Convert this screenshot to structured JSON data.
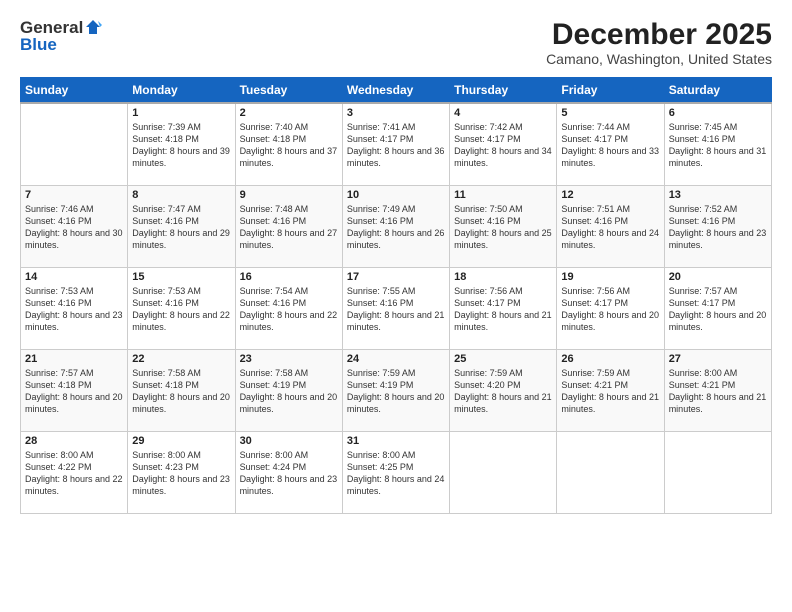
{
  "header": {
    "logo_general": "General",
    "logo_blue": "Blue",
    "month": "December 2025",
    "location": "Camano, Washington, United States"
  },
  "days_of_week": [
    "Sunday",
    "Monday",
    "Tuesday",
    "Wednesday",
    "Thursday",
    "Friday",
    "Saturday"
  ],
  "weeks": [
    [
      {
        "day": "",
        "sunrise": "",
        "sunset": "",
        "daylight": ""
      },
      {
        "day": "1",
        "sunrise": "Sunrise: 7:39 AM",
        "sunset": "Sunset: 4:18 PM",
        "daylight": "Daylight: 8 hours and 39 minutes."
      },
      {
        "day": "2",
        "sunrise": "Sunrise: 7:40 AM",
        "sunset": "Sunset: 4:18 PM",
        "daylight": "Daylight: 8 hours and 37 minutes."
      },
      {
        "day": "3",
        "sunrise": "Sunrise: 7:41 AM",
        "sunset": "Sunset: 4:17 PM",
        "daylight": "Daylight: 8 hours and 36 minutes."
      },
      {
        "day": "4",
        "sunrise": "Sunrise: 7:42 AM",
        "sunset": "Sunset: 4:17 PM",
        "daylight": "Daylight: 8 hours and 34 minutes."
      },
      {
        "day": "5",
        "sunrise": "Sunrise: 7:44 AM",
        "sunset": "Sunset: 4:17 PM",
        "daylight": "Daylight: 8 hours and 33 minutes."
      },
      {
        "day": "6",
        "sunrise": "Sunrise: 7:45 AM",
        "sunset": "Sunset: 4:16 PM",
        "daylight": "Daylight: 8 hours and 31 minutes."
      }
    ],
    [
      {
        "day": "7",
        "sunrise": "Sunrise: 7:46 AM",
        "sunset": "Sunset: 4:16 PM",
        "daylight": "Daylight: 8 hours and 30 minutes."
      },
      {
        "day": "8",
        "sunrise": "Sunrise: 7:47 AM",
        "sunset": "Sunset: 4:16 PM",
        "daylight": "Daylight: 8 hours and 29 minutes."
      },
      {
        "day": "9",
        "sunrise": "Sunrise: 7:48 AM",
        "sunset": "Sunset: 4:16 PM",
        "daylight": "Daylight: 8 hours and 27 minutes."
      },
      {
        "day": "10",
        "sunrise": "Sunrise: 7:49 AM",
        "sunset": "Sunset: 4:16 PM",
        "daylight": "Daylight: 8 hours and 26 minutes."
      },
      {
        "day": "11",
        "sunrise": "Sunrise: 7:50 AM",
        "sunset": "Sunset: 4:16 PM",
        "daylight": "Daylight: 8 hours and 25 minutes."
      },
      {
        "day": "12",
        "sunrise": "Sunrise: 7:51 AM",
        "sunset": "Sunset: 4:16 PM",
        "daylight": "Daylight: 8 hours and 24 minutes."
      },
      {
        "day": "13",
        "sunrise": "Sunrise: 7:52 AM",
        "sunset": "Sunset: 4:16 PM",
        "daylight": "Daylight: 8 hours and 23 minutes."
      }
    ],
    [
      {
        "day": "14",
        "sunrise": "Sunrise: 7:53 AM",
        "sunset": "Sunset: 4:16 PM",
        "daylight": "Daylight: 8 hours and 23 minutes."
      },
      {
        "day": "15",
        "sunrise": "Sunrise: 7:53 AM",
        "sunset": "Sunset: 4:16 PM",
        "daylight": "Daylight: 8 hours and 22 minutes."
      },
      {
        "day": "16",
        "sunrise": "Sunrise: 7:54 AM",
        "sunset": "Sunset: 4:16 PM",
        "daylight": "Daylight: 8 hours and 22 minutes."
      },
      {
        "day": "17",
        "sunrise": "Sunrise: 7:55 AM",
        "sunset": "Sunset: 4:16 PM",
        "daylight": "Daylight: 8 hours and 21 minutes."
      },
      {
        "day": "18",
        "sunrise": "Sunrise: 7:56 AM",
        "sunset": "Sunset: 4:17 PM",
        "daylight": "Daylight: 8 hours and 21 minutes."
      },
      {
        "day": "19",
        "sunrise": "Sunrise: 7:56 AM",
        "sunset": "Sunset: 4:17 PM",
        "daylight": "Daylight: 8 hours and 20 minutes."
      },
      {
        "day": "20",
        "sunrise": "Sunrise: 7:57 AM",
        "sunset": "Sunset: 4:17 PM",
        "daylight": "Daylight: 8 hours and 20 minutes."
      }
    ],
    [
      {
        "day": "21",
        "sunrise": "Sunrise: 7:57 AM",
        "sunset": "Sunset: 4:18 PM",
        "daylight": "Daylight: 8 hours and 20 minutes."
      },
      {
        "day": "22",
        "sunrise": "Sunrise: 7:58 AM",
        "sunset": "Sunset: 4:18 PM",
        "daylight": "Daylight: 8 hours and 20 minutes."
      },
      {
        "day": "23",
        "sunrise": "Sunrise: 7:58 AM",
        "sunset": "Sunset: 4:19 PM",
        "daylight": "Daylight: 8 hours and 20 minutes."
      },
      {
        "day": "24",
        "sunrise": "Sunrise: 7:59 AM",
        "sunset": "Sunset: 4:19 PM",
        "daylight": "Daylight: 8 hours and 20 minutes."
      },
      {
        "day": "25",
        "sunrise": "Sunrise: 7:59 AM",
        "sunset": "Sunset: 4:20 PM",
        "daylight": "Daylight: 8 hours and 21 minutes."
      },
      {
        "day": "26",
        "sunrise": "Sunrise: 7:59 AM",
        "sunset": "Sunset: 4:21 PM",
        "daylight": "Daylight: 8 hours and 21 minutes."
      },
      {
        "day": "27",
        "sunrise": "Sunrise: 8:00 AM",
        "sunset": "Sunset: 4:21 PM",
        "daylight": "Daylight: 8 hours and 21 minutes."
      }
    ],
    [
      {
        "day": "28",
        "sunrise": "Sunrise: 8:00 AM",
        "sunset": "Sunset: 4:22 PM",
        "daylight": "Daylight: 8 hours and 22 minutes."
      },
      {
        "day": "29",
        "sunrise": "Sunrise: 8:00 AM",
        "sunset": "Sunset: 4:23 PM",
        "daylight": "Daylight: 8 hours and 23 minutes."
      },
      {
        "day": "30",
        "sunrise": "Sunrise: 8:00 AM",
        "sunset": "Sunset: 4:24 PM",
        "daylight": "Daylight: 8 hours and 23 minutes."
      },
      {
        "day": "31",
        "sunrise": "Sunrise: 8:00 AM",
        "sunset": "Sunset: 4:25 PM",
        "daylight": "Daylight: 8 hours and 24 minutes."
      },
      {
        "day": "",
        "sunrise": "",
        "sunset": "",
        "daylight": ""
      },
      {
        "day": "",
        "sunrise": "",
        "sunset": "",
        "daylight": ""
      },
      {
        "day": "",
        "sunrise": "",
        "sunset": "",
        "daylight": ""
      }
    ]
  ]
}
